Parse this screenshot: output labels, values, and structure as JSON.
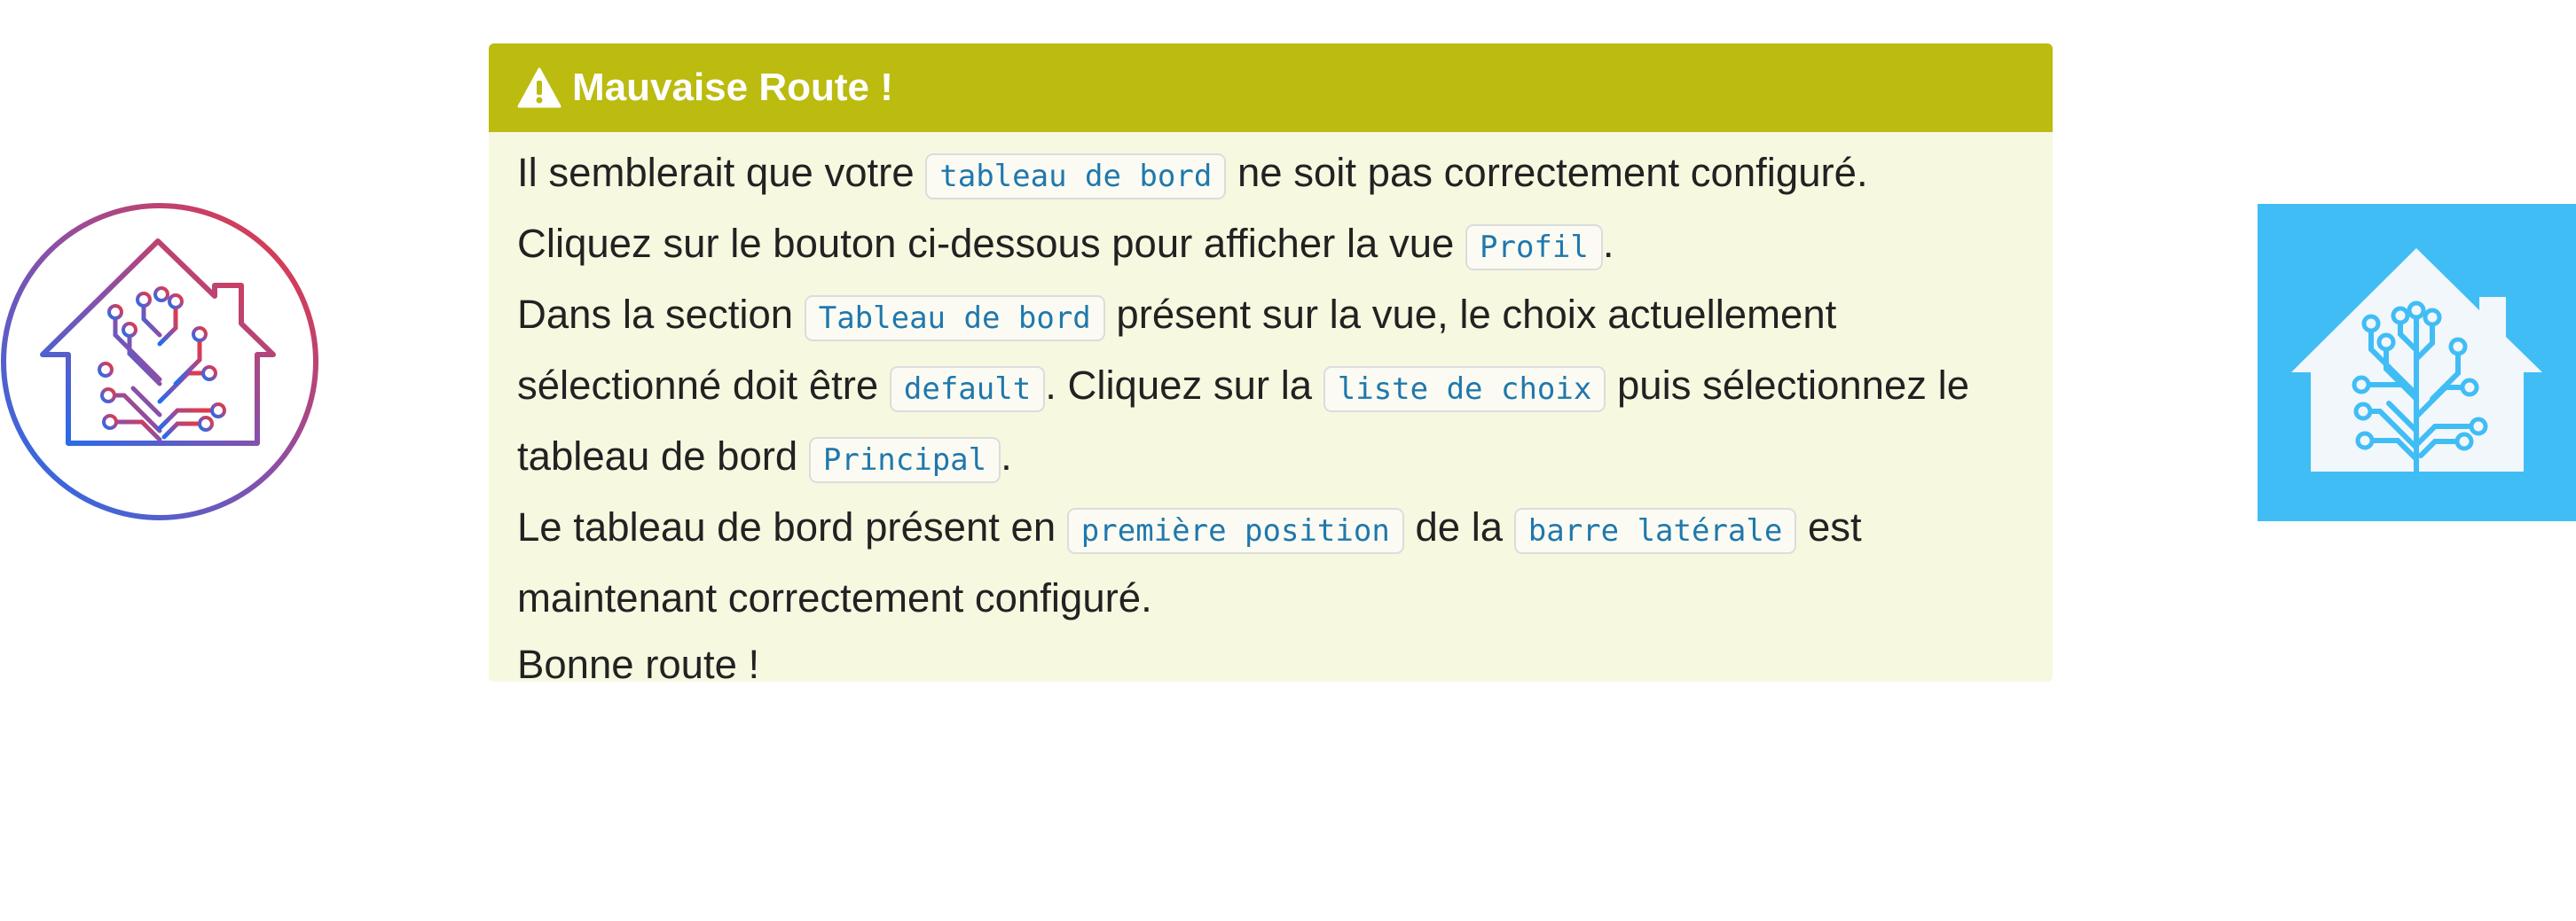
{
  "alert": {
    "title": "Mauvaise Route !",
    "icon": "warning-triangle-icon",
    "header_color": "#bbbb10",
    "body_background": "#f7f8e0"
  },
  "paragraphs": [
    {
      "t1": "Il semblerait que votre ",
      "c1": "tableau de bord",
      "t2": " ne soit pas correctement configuré."
    },
    {
      "t1": "Cliquez sur le bouton ci-dessous pour afficher la vue ",
      "c1": "Profil",
      "t2": "."
    },
    {
      "l1a": "Dans la section ",
      "l1code": "Tableau de bord",
      "l1b": " présent sur la vue, le choix actuellement",
      "l2a": "sélectionné doit être ",
      "l2code1": "default",
      "l2b": ". Cliquez sur la ",
      "l2code2": "liste de choix",
      "l2c": " puis sélectionnez le",
      "l3a": "tableau de bord ",
      "l3code": "Principal",
      "l3b": "."
    },
    {
      "l1a": "Le tableau de bord présent en ",
      "l1code1": "première position",
      "l1b": " de la ",
      "l1code2": "barre latérale",
      "l1c": " est",
      "l2a": "maintenant correctement configuré."
    },
    {
      "t1": "Bonne route !"
    }
  ],
  "logos": {
    "left": "home-assistant-gradient-logo-icon",
    "right": "home-assistant-blue-logo-icon",
    "right_background": "#41bdf5"
  }
}
